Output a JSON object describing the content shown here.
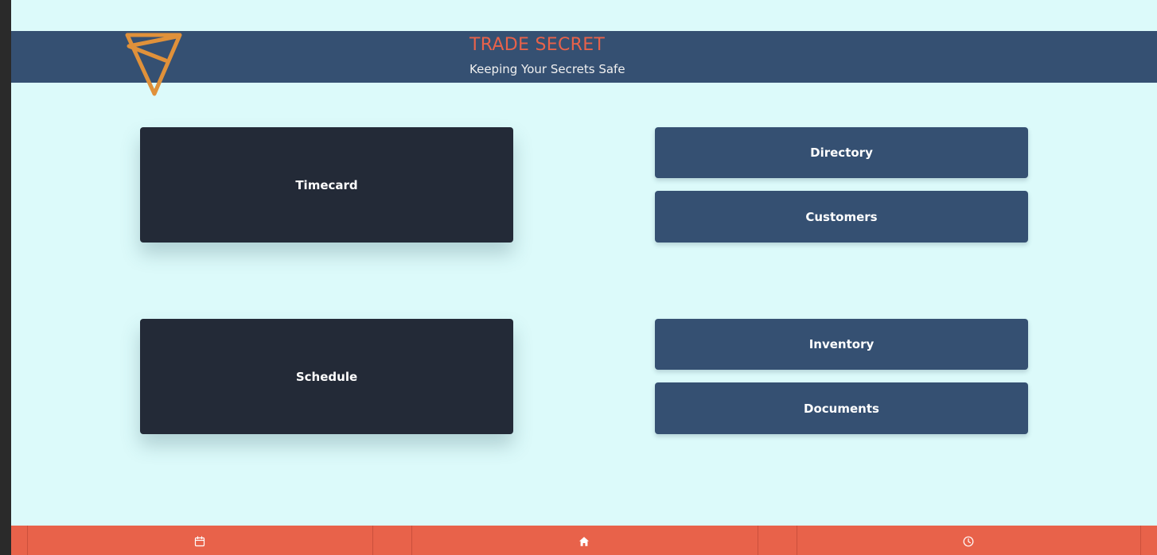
{
  "header": {
    "title": "TRADE SECRET",
    "tagline": "Keeping Your Secrets Safe",
    "logo_icon": "triangle-s-logo-icon"
  },
  "tiles": {
    "timecard": "Timecard",
    "schedule": "Schedule",
    "directory": "Directory",
    "customers": "Customers",
    "inventory": "Inventory",
    "documents": "Documents"
  },
  "footer": {
    "icons": [
      "calendar-icon",
      "home-icon",
      "clock-icon"
    ]
  },
  "colors": {
    "background": "#dcfafa",
    "header": "#355072",
    "accent": "#e8624a",
    "logo": "#e0913a",
    "dark_tile": "#232a37",
    "blue_tile": "#355072"
  }
}
